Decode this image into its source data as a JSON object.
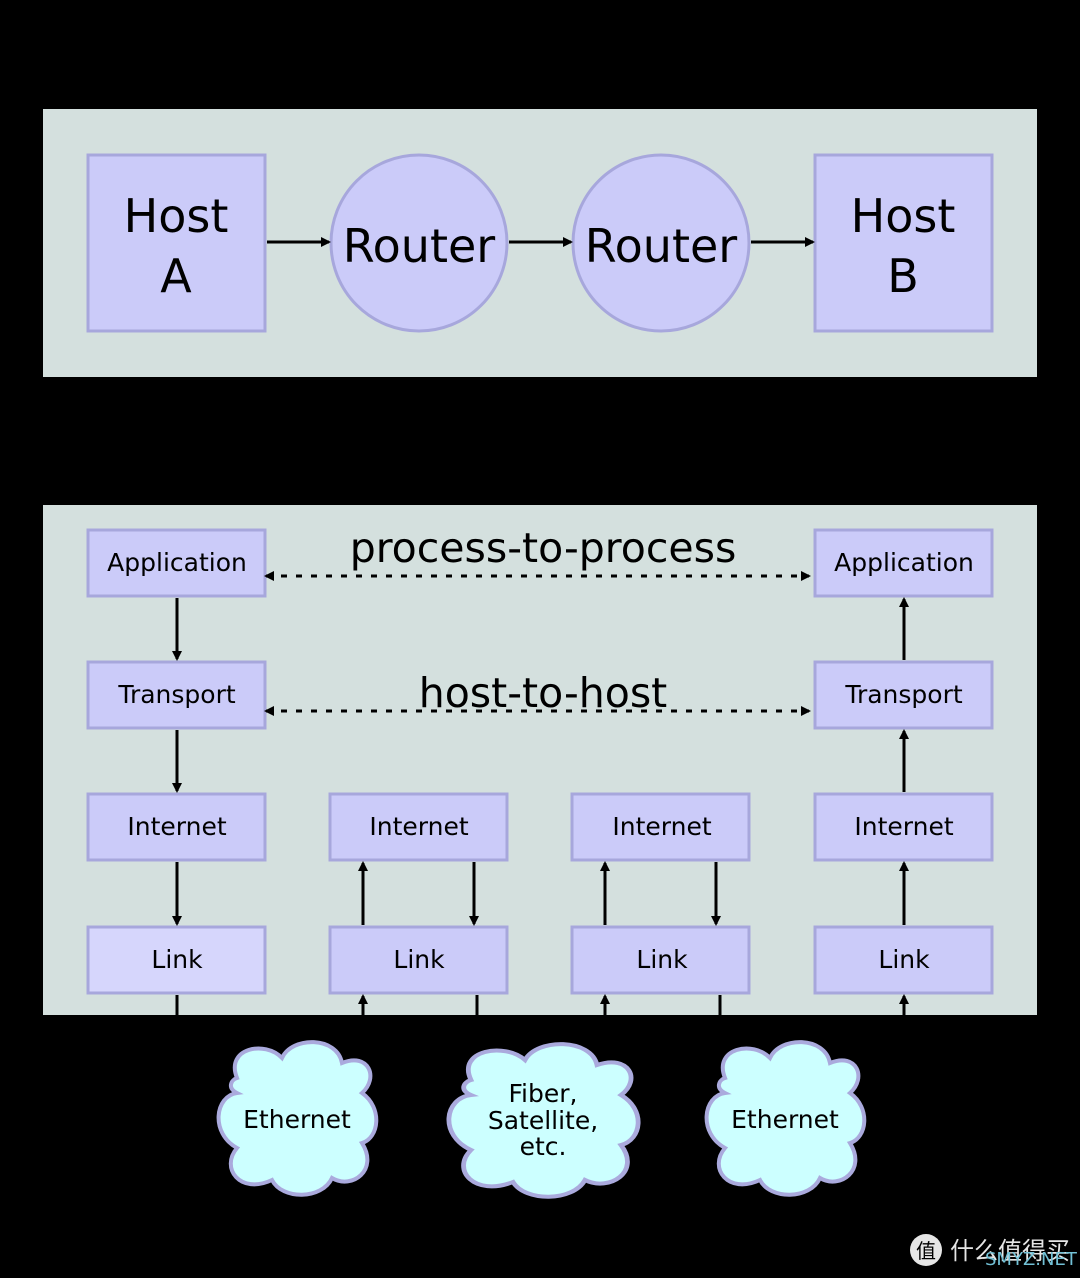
{
  "topology": {
    "host_a": [
      "Host",
      "A"
    ],
    "router_1": "Router",
    "router_2": "Router",
    "host_b": [
      "Host",
      "B"
    ]
  },
  "layers": {
    "process_label": "process-to-process",
    "host_label": "host-to-host",
    "host_a": {
      "application": "Application",
      "transport": "Transport",
      "internet": "Internet",
      "link": "Link"
    },
    "router_1": {
      "internet": "Internet",
      "link": "Link"
    },
    "router_2": {
      "internet": "Internet",
      "link": "Link"
    },
    "host_b": {
      "application": "Application",
      "transport": "Transport",
      "internet": "Internet",
      "link": "Link"
    }
  },
  "networks": {
    "left": [
      "Ethernet"
    ],
    "middle": [
      "Fiber,",
      "Satellite,",
      "etc."
    ],
    "right": [
      "Ethernet"
    ]
  },
  "watermark": {
    "logo": "值",
    "text": "什么值得买",
    "overlay": "SMYZ.NET"
  },
  "colors": {
    "panel": "#d4e0de",
    "box": "#cbcbf9",
    "border": "#a7a7dc",
    "cloud": "#ccffff"
  }
}
